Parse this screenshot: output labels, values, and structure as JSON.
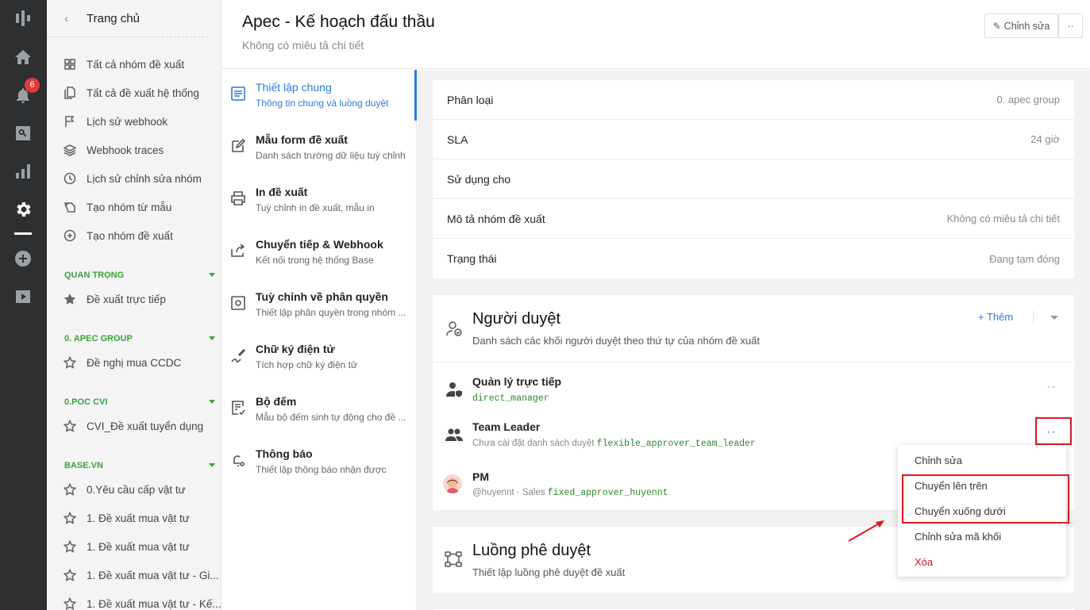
{
  "header": {
    "title": "Apec - Kế hoạch đấu thầu",
    "subtitle": "Không có miêu tả chi tiết",
    "edit_label": "Chỉnh sửa",
    "more_label": "··"
  },
  "rail": {
    "badge": "6",
    "icons": [
      "logo-icon",
      "home-icon",
      "bell-icon",
      "search-icon",
      "chart-icon",
      "gear-icon",
      "plus-circle-icon",
      "play-icon"
    ]
  },
  "nav": {
    "title": "Trang chủ",
    "items": [
      {
        "label": "Tất cả nhóm đề xuất",
        "icon": "grid-icon"
      },
      {
        "label": "Tất cả đề xuất hệ thống",
        "icon": "documents-icon"
      },
      {
        "label": "Lịch sử webhook",
        "icon": "flag-icon"
      },
      {
        "label": "Webhook traces",
        "icon": "layers-icon"
      },
      {
        "label": "Lịch sử chỉnh sửa nhóm",
        "icon": "clock-icon"
      },
      {
        "label": "Tạo nhóm từ mẫu",
        "icon": "template-icon"
      },
      {
        "label": "Tạo nhóm đề xuất",
        "icon": "plus-circle-icon"
      }
    ],
    "sections": [
      {
        "title": "QUAN TRỌNG",
        "items": [
          "Đề xuất trực tiếp"
        ]
      },
      {
        "title": "0. APEC GROUP",
        "items": [
          "Đề nghị mua CCDC"
        ]
      },
      {
        "title": "0.POC CVI",
        "items": [
          "CVI_Đề xuất tuyển dụng"
        ]
      },
      {
        "title": "BASE.VN",
        "items": [
          "0.Yêu cầu cấp vật tư",
          "1. Đề xuất mua vật tư",
          "1. Đề xuất mua vật tư",
          "1. Đề xuất mua vật tư - Gi...",
          "1. Đề xuất mua vật tư - Kế..."
        ]
      }
    ]
  },
  "settings": [
    {
      "title": "Thiết lập chung",
      "desc": "Thông tin chung và luồng duyệt",
      "active": true
    },
    {
      "title": "Mẫu form đề xuất",
      "desc": "Danh sách trường dữ liệu tuỳ chỉnh"
    },
    {
      "title": "In đề xuất",
      "desc": "Tuỳ chỉnh in đề xuất, mẫu in"
    },
    {
      "title": "Chuyển tiếp & Webhook",
      "desc": "Kết nối trong hệ thống Base"
    },
    {
      "title": "Tuỳ chỉnh về phân quyền",
      "desc": "Thiết lập phân quyền trong nhóm ..."
    },
    {
      "title": "Chữ ký điện tử",
      "desc": "Tích hợp chữ ký điện tử"
    },
    {
      "title": "Bộ đếm",
      "desc": "Mẫu bộ đếm sinh tự động cho đề ..."
    },
    {
      "title": "Thông báo",
      "desc": "Thiết lập thông báo nhận được"
    }
  ],
  "properties": [
    {
      "label": "Phân loại",
      "value": "0. apec group"
    },
    {
      "label": "SLA",
      "value": "24 giờ"
    },
    {
      "label": "Sử dụng cho",
      "value": ""
    },
    {
      "label": "Mô tả nhóm đề xuất",
      "value": "Không có miêu tả chi tiết"
    },
    {
      "label": "Trạng thái",
      "value": "Đang tạm đóng"
    }
  ],
  "approvers": {
    "title": "Người duyệt",
    "desc": "Danh sách các khối người duyệt theo thứ tự của nhóm đề xuất",
    "add_label": "+ Thêm",
    "blocks": [
      {
        "name": "Quản lý trực tiếp",
        "prefix": "",
        "code": "direct_manager"
      },
      {
        "name": "Team Leader",
        "prefix": "Chưa cài đặt danh sách duyệt",
        "code": "flexible_approver_team_leader"
      },
      {
        "name": "PM",
        "prefix": "@huyennt · Sales",
        "code": "fixed_approver_huyennt"
      }
    ]
  },
  "flow": {
    "title": "Luồng phê duyệt",
    "desc": "Thiết lập luồng phê duyệt đề xuất"
  },
  "menu": [
    "Chỉnh sửa",
    "Chuyển lên trên",
    "Chuyển xuống dưới",
    "Chỉnh sửa mã khối",
    "Xóa"
  ],
  "colors": {
    "accent": "#2a7ae2",
    "green": "#3aa33a",
    "danger": "#c0162a",
    "highlight": "#e0161e"
  }
}
